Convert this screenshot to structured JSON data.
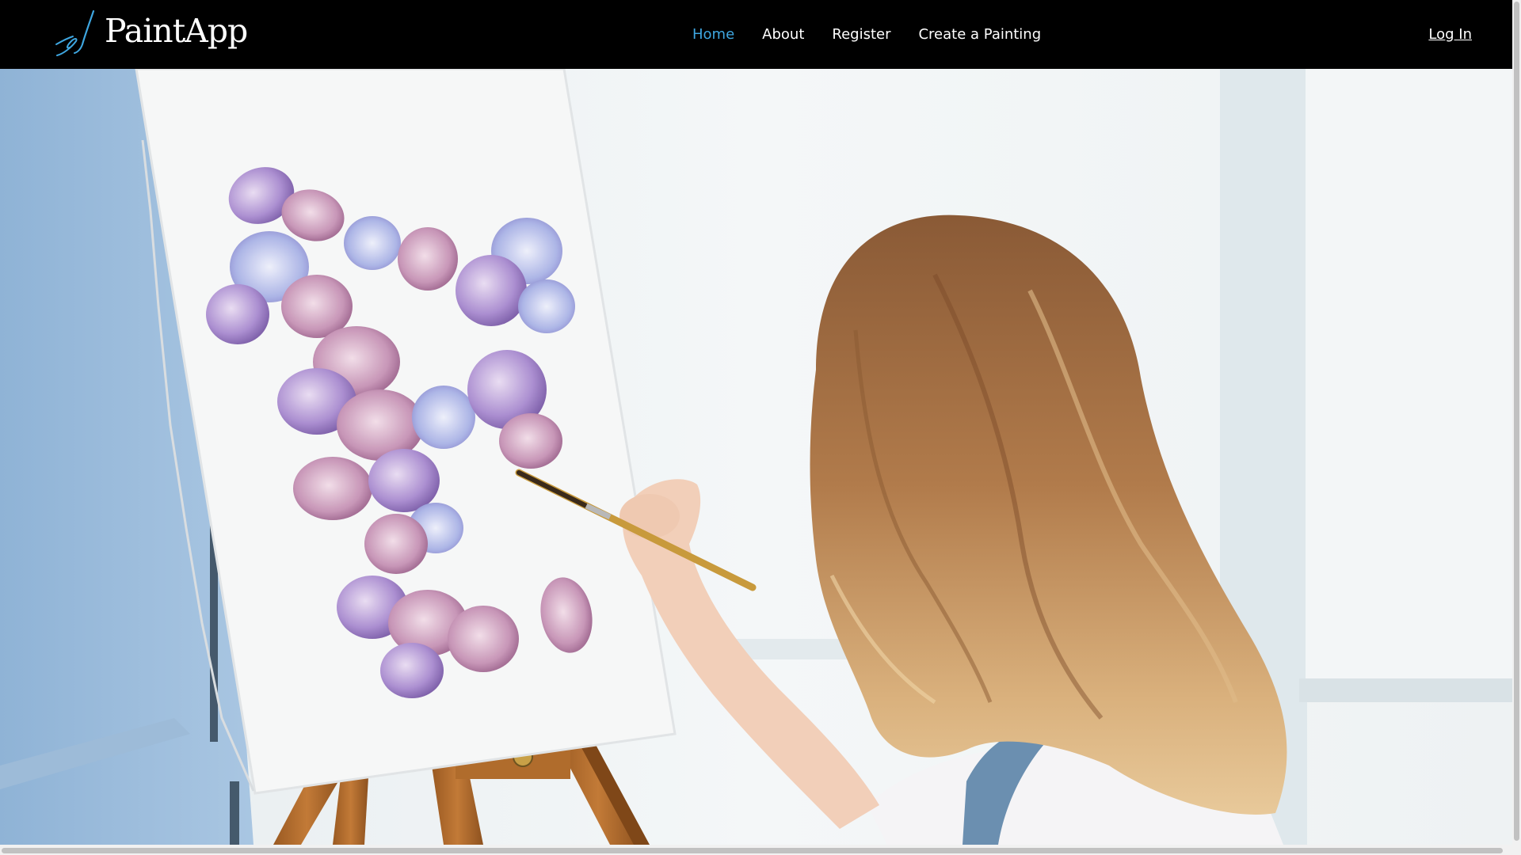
{
  "brand": {
    "name": "PaintApp",
    "icon": "paintbrush-icon",
    "icon_color": "#3ea6e0"
  },
  "nav": {
    "items": [
      {
        "label": "Home",
        "active": true
      },
      {
        "label": "About",
        "active": false
      },
      {
        "label": "Register",
        "active": false
      },
      {
        "label": "Create a Painting",
        "active": false
      }
    ],
    "login_label": "Log In",
    "active_color": "#3ea6e0",
    "background": "#000000"
  },
  "hero": {
    "image": "woman-painting-flowers-on-easel-photo"
  }
}
